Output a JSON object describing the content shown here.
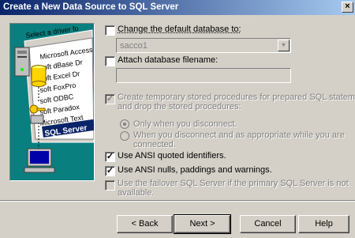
{
  "window": {
    "title": "Create a New Data Source to SQL Server",
    "close_glyph": "×"
  },
  "illustration": {
    "header": "Select a driver fo",
    "drivers": [
      "Microsoft Access D",
      "soft dBase Dr",
      "soft Excel Dr",
      "soft FoxPro",
      "soft ODBC",
      "soft Paradox",
      "Microsoft Text",
      "SQL Server"
    ]
  },
  "options": {
    "change_default_db": {
      "label": "Change the default database to:",
      "checked": false
    },
    "default_db_value": "sacco1",
    "attach_db": {
      "label": "Attach database filename:",
      "checked": false
    },
    "create_temp": {
      "label_line1": "Create temporary stored procedures for prepared SQL statements",
      "label_line2": "and drop the stored procedures:",
      "checked": true
    },
    "radio_only_disconnect": {
      "label": "Only when you disconnect."
    },
    "radio_when_disconnect": {
      "label_line1": "When you disconnect and as appropriate while you are",
      "label_line2": "connected."
    },
    "ansi_quoted": {
      "label": "Use ANSI quoted identifiers.",
      "checked": true
    },
    "ansi_nulls": {
      "label": "Use ANSI nulls, paddings and warnings.",
      "checked": true
    },
    "failover": {
      "label_line1": "Use the failover SQL Server if the primary SQL Server is not",
      "label_line2": "available.",
      "checked": false
    }
  },
  "buttons": {
    "back": "< Back",
    "next": "Next >",
    "cancel": "Cancel",
    "help": "Help"
  }
}
